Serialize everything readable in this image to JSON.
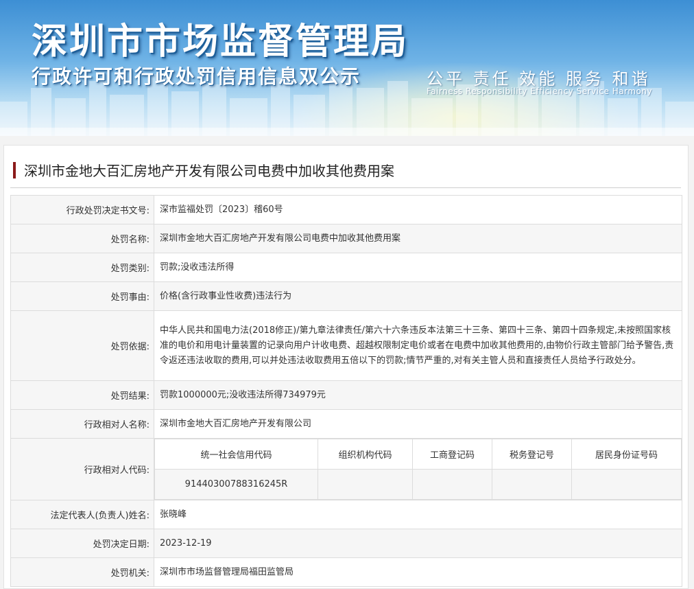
{
  "header": {
    "title": "深圳市市场监督管理局",
    "subtitle": "行政许可和行政处罚信用信息双公示",
    "slogan_cn": "公平  责任  效能  服务  和谐",
    "slogan_en": "Fairness  Responsibility  Efficiency  Service  Harmony"
  },
  "case": {
    "title": "深圳市金地大百汇房地产开发有限公司电费中加收其他费用案"
  },
  "rows": [
    {
      "label": "行政处罚决定书文号:",
      "value": "深市监福处罚〔2023〕稽60号"
    },
    {
      "label": "处罚名称:",
      "value": "深圳市金地大百汇房地产开发有限公司电费中加收其他费用案"
    },
    {
      "label": "处罚类别:",
      "value": "罚款;没收违法所得"
    },
    {
      "label": "处罚事由:",
      "value": "价格(含行政事业性收费)违法行为"
    },
    {
      "label": "处罚依据:",
      "value": "中华人民共和国电力法(2018修正)/第九章法律责任/第六十六条违反本法第三十三条、第四十三条、第四十四条规定,未按照国家核准的电价和用电计量装置的记录向用户计收电费、超越权限制定电价或者在电费中加收其他费用的,由物价行政主管部门给予警告,责令返还违法收取的费用,可以并处违法收取费用五倍以下的罚款;情节严重的,对有关主管人员和直接责任人员给予行政处分。"
    },
    {
      "label": "处罚结果:",
      "value": "罚款1000000元;没收违法所得734979元"
    },
    {
      "label": "行政相对人名称:",
      "value": "深圳市金地大百汇房地产开发有限公司"
    }
  ],
  "codes": {
    "label": "行政相对人代码:",
    "headers": [
      "统一社会信用代码",
      "组织机构代码",
      "工商登记码",
      "税务登记号",
      "居民身份证号码"
    ],
    "values": [
      "91440300788316245R",
      "",
      "",
      "",
      ""
    ]
  },
  "rows_after": [
    {
      "label": "法定代表人(负责人)姓名:",
      "value": "张晓峰"
    },
    {
      "label": "处罚决定日期:",
      "value": "2023-12-19"
    },
    {
      "label": "处罚机关:",
      "value": "深圳市市场监督管理局福田监管局"
    }
  ]
}
